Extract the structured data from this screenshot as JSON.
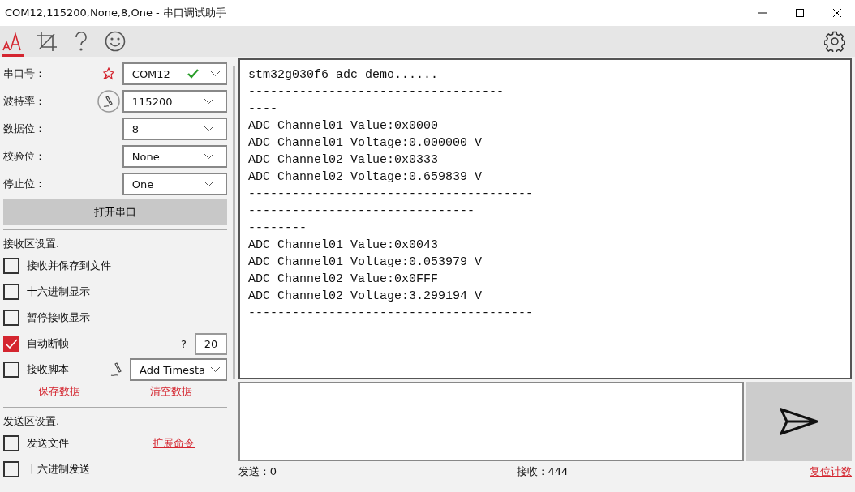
{
  "window": {
    "title": "COM12,115200,None,8,One - 串口调试助手"
  },
  "toolbar": {
    "tabs": [
      {
        "selected": true
      },
      {
        "selected": false
      },
      {
        "selected": false
      },
      {
        "selected": false
      }
    ]
  },
  "serial_settings": [
    {
      "label": "串口号 :",
      "value": "COM12",
      "connected": true
    },
    {
      "label": "波特率 :",
      "value": "115200",
      "connected": false
    },
    {
      "label": "数据位 :",
      "value": "8",
      "connected": false
    },
    {
      "label": "校验位 :",
      "value": "None",
      "connected": false
    },
    {
      "label": "停止位 :",
      "value": "One",
      "connected": false
    }
  ],
  "open_button": "打开串口",
  "receive_settings": {
    "title": "接收区设置.",
    "options": [
      {
        "kind": "checkbox",
        "label": "接收并保存到文件",
        "checked": false
      },
      {
        "kind": "checkbox",
        "label": "十六进制显示",
        "checked": false
      },
      {
        "kind": "checkbox",
        "label": "暂停接收显示",
        "checked": false
      },
      {
        "kind": "number",
        "label": "自动断帧",
        "checked": true,
        "hint": "?",
        "value": "20"
      },
      {
        "kind": "dropdown",
        "label": "接收脚本",
        "checked": false,
        "value": "Add Timesta"
      }
    ],
    "links": [
      "保存数据",
      "清空数据"
    ]
  },
  "send_settings": {
    "title": "发送区设置.",
    "options": [
      {
        "kind": "link",
        "label": "发送文件",
        "checked": false,
        "link": "扩展命令"
      },
      {
        "kind": "checkbox",
        "label": "十六进制发送",
        "checked": false
      }
    ]
  },
  "receive_area": {
    "lines": [
      "stm32g030f6 adc demo......",
      "-----------------------------------",
      "----",
      "ADC Channel01 Value:0x0000",
      "ADC Channel01 Voltage:0.000000 V",
      "ADC Channel02 Value:0x0333",
      "ADC Channel02 Voltage:0.659839 V",
      "---------------------------------------",
      "-------------------------------",
      "--------",
      "ADC Channel01 Value:0x0043",
      "ADC Channel01 Voltage:0.053979 V",
      "ADC Channel02 Value:0x0FFF",
      "ADC Channel02 Voltage:3.299194 V",
      "---------------------------------------"
    ]
  },
  "status_bar": {
    "sent": "发送 : 0",
    "received": "接收 : 444",
    "reset": "复位计数"
  }
}
